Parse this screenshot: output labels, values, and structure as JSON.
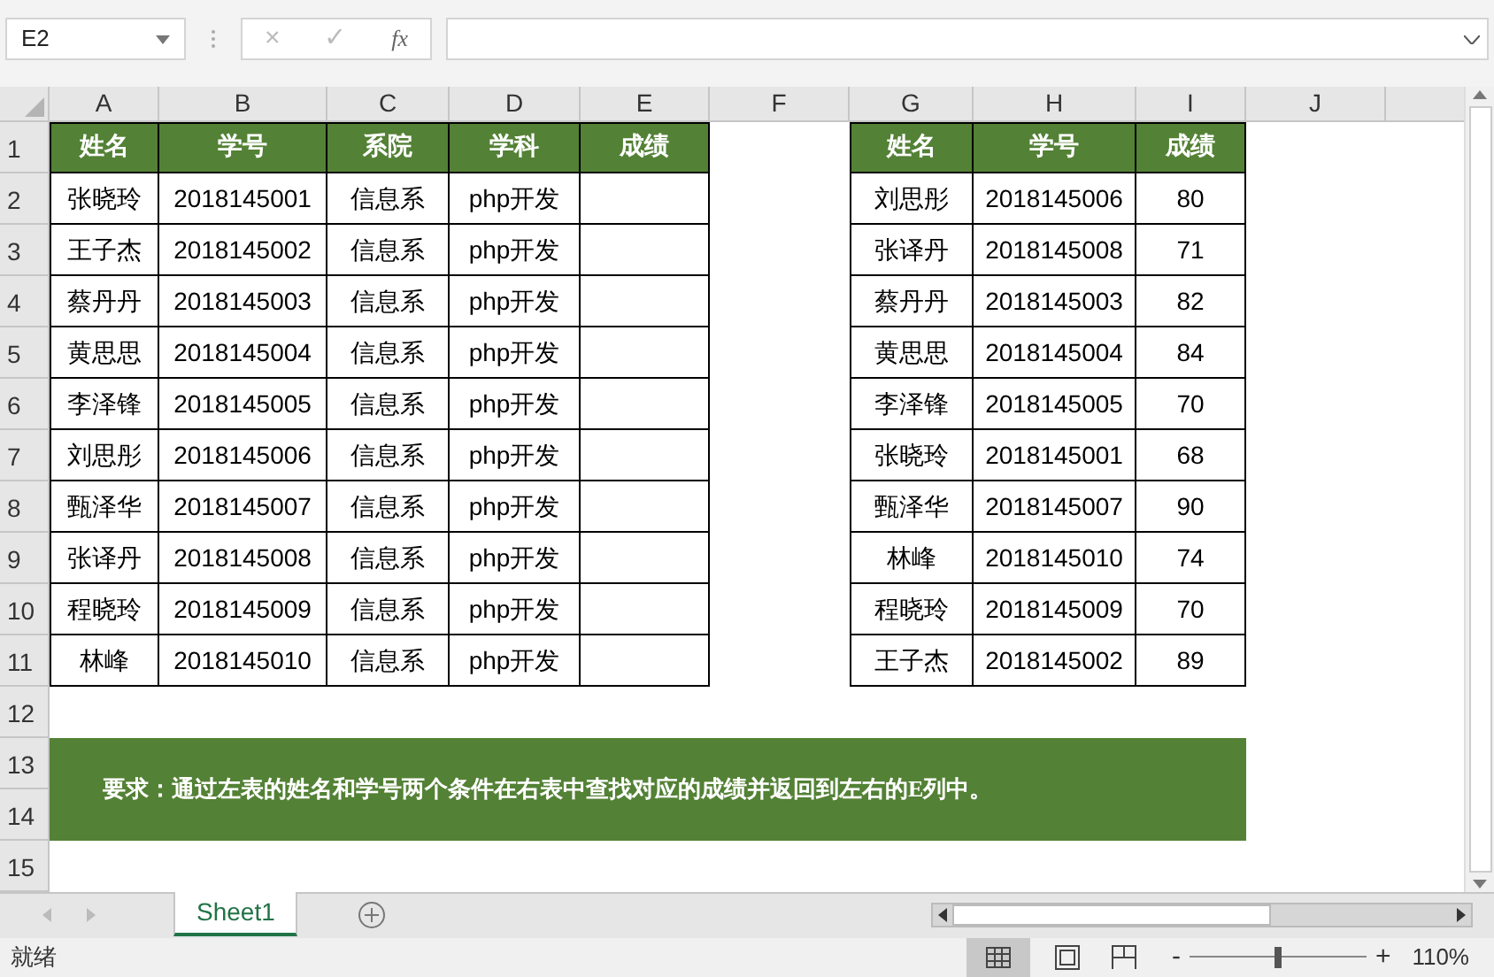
{
  "name_box": "E2",
  "formula_bar": {
    "cancel": "×",
    "enter": "✓",
    "fx": "fx"
  },
  "columns": [
    "A",
    "B",
    "C",
    "D",
    "E",
    "F",
    "G",
    "H",
    "I",
    "J"
  ],
  "rows": [
    "1",
    "2",
    "3",
    "4",
    "5",
    "6",
    "7",
    "8",
    "9",
    "10",
    "11",
    "12",
    "13",
    "14",
    "15"
  ],
  "left_table": {
    "headers": [
      "姓名",
      "学号",
      "系院",
      "学科",
      "成绩"
    ],
    "rows": [
      [
        "张晓玲",
        "2018145001",
        "信息系",
        "php开发",
        ""
      ],
      [
        "王子杰",
        "2018145002",
        "信息系",
        "php开发",
        ""
      ],
      [
        "蔡丹丹",
        "2018145003",
        "信息系",
        "php开发",
        ""
      ],
      [
        "黄思思",
        "2018145004",
        "信息系",
        "php开发",
        ""
      ],
      [
        "李泽锋",
        "2018145005",
        "信息系",
        "php开发",
        ""
      ],
      [
        "刘思彤",
        "2018145006",
        "信息系",
        "php开发",
        ""
      ],
      [
        "甄泽华",
        "2018145007",
        "信息系",
        "php开发",
        ""
      ],
      [
        "张译丹",
        "2018145008",
        "信息系",
        "php开发",
        ""
      ],
      [
        "程晓玲",
        "2018145009",
        "信息系",
        "php开发",
        ""
      ],
      [
        "林峰",
        "2018145010",
        "信息系",
        "php开发",
        ""
      ]
    ]
  },
  "right_table": {
    "headers": [
      "姓名",
      "学号",
      "成绩"
    ],
    "rows": [
      [
        "刘思彤",
        "2018145006",
        "80"
      ],
      [
        "张译丹",
        "2018145008",
        "71"
      ],
      [
        "蔡丹丹",
        "2018145003",
        "82"
      ],
      [
        "黄思思",
        "2018145004",
        "84"
      ],
      [
        "李泽锋",
        "2018145005",
        "70"
      ],
      [
        "张晓玲",
        "2018145001",
        "68"
      ],
      [
        "甄泽华",
        "2018145007",
        "90"
      ],
      [
        "林峰",
        "2018145010",
        "74"
      ],
      [
        "程晓玲",
        "2018145009",
        "70"
      ],
      [
        "王子杰",
        "2018145002",
        "89"
      ]
    ]
  },
  "banner": "要求：通过左表的姓名和学号两个条件在右表中查找对应的成绩并返回到左右的E列中。",
  "sheet_tabs": [
    {
      "label": "Sheet1",
      "selected": true
    }
  ],
  "status_bar": {
    "status": "就绪",
    "zoom_minus": "-",
    "zoom_plus": "+",
    "zoom": "110%",
    "zoom_slider": {
      "level": 0.5
    }
  }
}
